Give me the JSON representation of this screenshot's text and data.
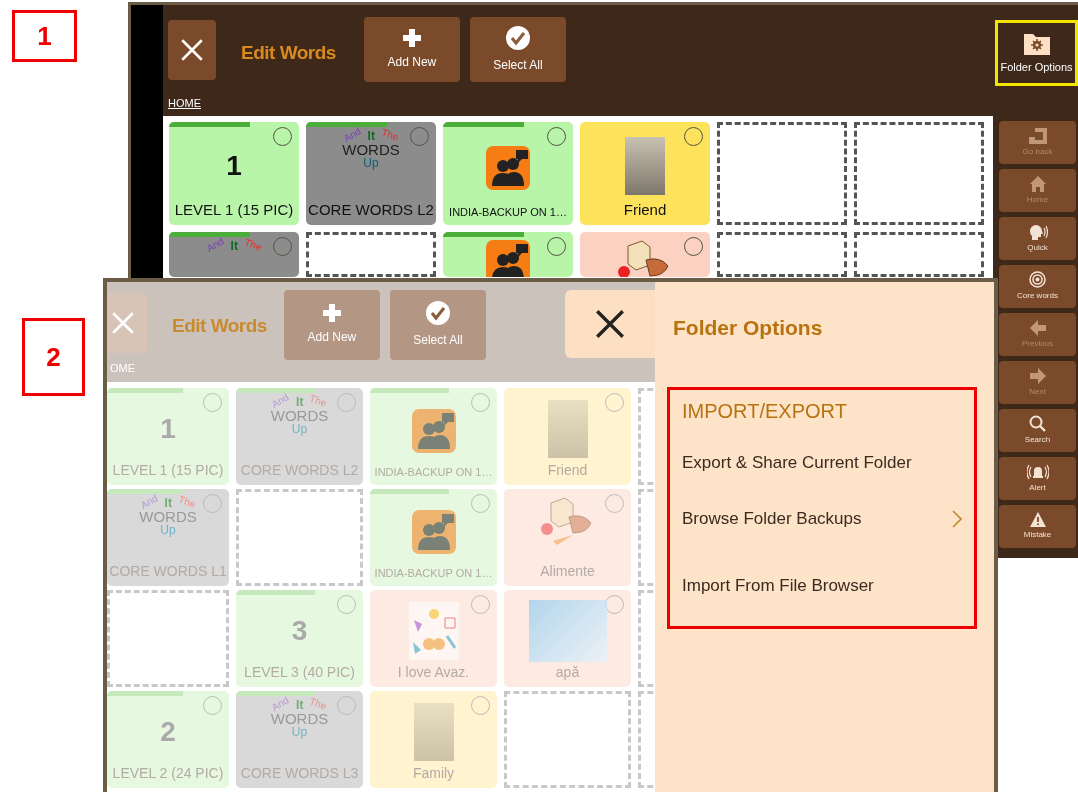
{
  "callouts": [
    "1",
    "2"
  ],
  "screen_1": {
    "header": {
      "title": "Edit Words",
      "buttons": [
        {
          "kind": "add",
          "label": "Add New"
        },
        {
          "kind": "select",
          "label": "Select All"
        }
      ],
      "folder_options": {
        "label": "Folder Options",
        "highlighted": true
      }
    },
    "breadcrumb": "HOME",
    "tiles": [
      {
        "kind": "level",
        "number": "1",
        "label": "LEVEL 1 (15 PIC)",
        "color": "#b9f5a8",
        "folder": true,
        "selected": false
      },
      {
        "kind": "core",
        "logo": {
          "words": [
            "And",
            "It",
            "The"
          ],
          "main": "WORDS",
          "sub": "Up"
        },
        "label": "CORE WORDS L2",
        "color": "#8c8c8c",
        "folder": true,
        "selected": false
      },
      {
        "kind": "avatar",
        "label": "INDIA-BACKUP ON 1…",
        "color": "#b9f5a8",
        "folder": true,
        "selected": false
      },
      {
        "kind": "photo",
        "label": "Friend",
        "color": "#fde35c",
        "folder": false,
        "selected": false
      },
      {
        "kind": "empty"
      },
      {
        "kind": "empty"
      },
      {
        "kind": "core",
        "logo": {
          "words": [
            "And",
            "It",
            "The"
          ]
        },
        "color": "#8c8c8c",
        "folder": true,
        "selected": false
      },
      {
        "kind": "empty"
      },
      {
        "kind": "avatar",
        "color": "#b9f5a8",
        "folder": true,
        "selected": false
      },
      {
        "kind": "food",
        "color": "#fbd2c2",
        "folder": false,
        "selected": false
      },
      {
        "kind": "empty"
      },
      {
        "kind": "empty"
      }
    ],
    "sidebar": [
      {
        "kind": "back",
        "label": "Go back",
        "disabled": true
      },
      {
        "kind": "home",
        "label": "Home",
        "disabled": true
      },
      {
        "kind": "quick",
        "label": "Quick",
        "disabled": false
      },
      {
        "kind": "core",
        "label": "Core words",
        "disabled": false
      },
      {
        "kind": "previous",
        "label": "Previous",
        "disabled": true
      },
      {
        "kind": "next",
        "label": "Next",
        "disabled": true
      },
      {
        "kind": "search",
        "label": "Search",
        "disabled": false
      },
      {
        "kind": "alert",
        "label": "Alert",
        "disabled": false
      },
      {
        "kind": "mistake",
        "label": "Mistake",
        "disabled": false
      }
    ]
  },
  "screen_2": {
    "header": {
      "title": "Edit Words",
      "buttons": [
        {
          "kind": "add",
          "label": "Add New"
        },
        {
          "kind": "select",
          "label": "Select All"
        }
      ]
    },
    "breadcrumb": "OME",
    "tiles": [
      {
        "kind": "level",
        "number": "1",
        "label": "LEVEL 1 (15 PIC)",
        "color": "#e6f9e0",
        "folder": true,
        "selected": false
      },
      {
        "kind": "core",
        "logo": {
          "words": [
            "And",
            "It",
            "The"
          ],
          "main": "WORDS",
          "sub": "Up"
        },
        "label": "CORE WORDS L2",
        "color": "#d9d9d9",
        "folder": true,
        "selected": false
      },
      {
        "kind": "avatar",
        "label": "INDIA-BACKUP ON 1…",
        "color": "#e6f9e0",
        "folder": true,
        "selected": false
      },
      {
        "kind": "photo",
        "label": "Friend",
        "color": "#fff4cf",
        "folder": false,
        "selected": false
      },
      {
        "kind": "empty"
      },
      {
        "kind": "core",
        "logo": {
          "words": [
            "And",
            "It",
            "The"
          ],
          "main": "WORDS",
          "sub": "Up"
        },
        "label": "CORE WORDS L1",
        "color": "#d9d9d9",
        "folder": true,
        "selected": false
      },
      {
        "kind": "empty"
      },
      {
        "kind": "avatar",
        "label": "INDIA-BACKUP ON 1…",
        "color": "#e6f9e0",
        "folder": true,
        "selected": false
      },
      {
        "kind": "food",
        "label": "Alimente",
        "color": "#fdebe3",
        "folder": false,
        "selected": false
      },
      {
        "kind": "empty"
      },
      {
        "kind": "empty"
      },
      {
        "kind": "level",
        "number": "3",
        "label": "LEVEL 3 (40 PIC)",
        "color": "#e6f9e0",
        "folder": true,
        "selected": false
      },
      {
        "kind": "collage",
        "label": "I love Avaz.",
        "color": "#fdebe3",
        "folder": false,
        "selected": false
      },
      {
        "kind": "water",
        "label": "apă",
        "color": "#fdebe3",
        "folder": false,
        "selected": false
      },
      {
        "kind": "empty"
      },
      {
        "kind": "level",
        "number": "2",
        "label": "LEVEL 2 (24 PIC)",
        "color": "#e6f9e0",
        "folder": true,
        "selected": false
      },
      {
        "kind": "core",
        "logo": {
          "words": [
            "And",
            "It",
            "The"
          ],
          "main": "WORDS",
          "sub": "Up"
        },
        "label": "CORE WORDS L3",
        "color": "#d9d9d9",
        "folder": true,
        "selected": false
      },
      {
        "kind": "photo",
        "label": "Family",
        "color": "#fff4cf",
        "folder": false,
        "selected": false
      },
      {
        "kind": "empty"
      },
      {
        "kind": "empty"
      }
    ],
    "panel": {
      "title": "Folder Options",
      "section": {
        "title": "IMPORT/EXPORT",
        "highlighted": true,
        "items": [
          {
            "label": "Export & Share Current Folder",
            "submenu": false
          },
          {
            "label": "Browse Folder Backups",
            "submenu": true
          },
          {
            "label": "Import From File Browser",
            "submenu": false
          }
        ]
      }
    }
  }
}
